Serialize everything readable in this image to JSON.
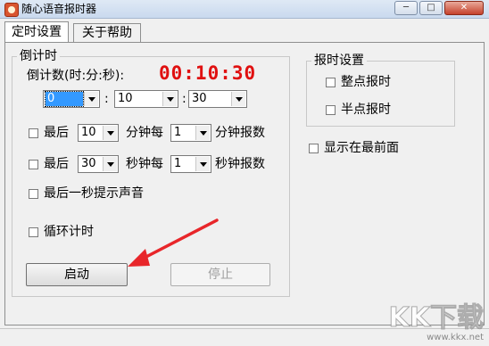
{
  "window": {
    "title": "随心语音报时器",
    "controls": {
      "minimize": "─",
      "maximize": "□",
      "close": "✕"
    }
  },
  "tabs": [
    {
      "label": "定时设置",
      "active": true
    },
    {
      "label": "关于帮助",
      "active": false
    }
  ],
  "countdown": {
    "group_title": "倒计时",
    "label": "倒计数(时:分:秒):",
    "timer": "00:10:30",
    "hours": "0",
    "minutes": "10",
    "seconds": "30",
    "sep": ":"
  },
  "minute_rule": {
    "prefix": "最后",
    "value1": "10",
    "middle": "分钟每",
    "value2": "1",
    "suffix": "分钟报数",
    "checked": false
  },
  "second_rule": {
    "prefix": "最后",
    "value1": "30",
    "middle": "秒钟每",
    "value2": "1",
    "suffix": "秒钟报数",
    "checked": false
  },
  "last_second": {
    "label": "最后一秒提示声音",
    "checked": false
  },
  "loop": {
    "label": "循环计时",
    "checked": false
  },
  "buttons": {
    "start": "启动",
    "stop": "停止"
  },
  "chime": {
    "group_title": "报时设置",
    "hourly": {
      "label": "整点报时",
      "checked": false
    },
    "half_hour": {
      "label": "半点报时",
      "checked": false
    }
  },
  "topmost": {
    "label": "显示在最前面",
    "checked": false
  },
  "watermark": {
    "brand": "KK下载",
    "url": "www.kkx.net"
  },
  "colors": {
    "timer": "#e01010",
    "annotation_arrow": "#e8262a",
    "selection": "#3399ff"
  }
}
